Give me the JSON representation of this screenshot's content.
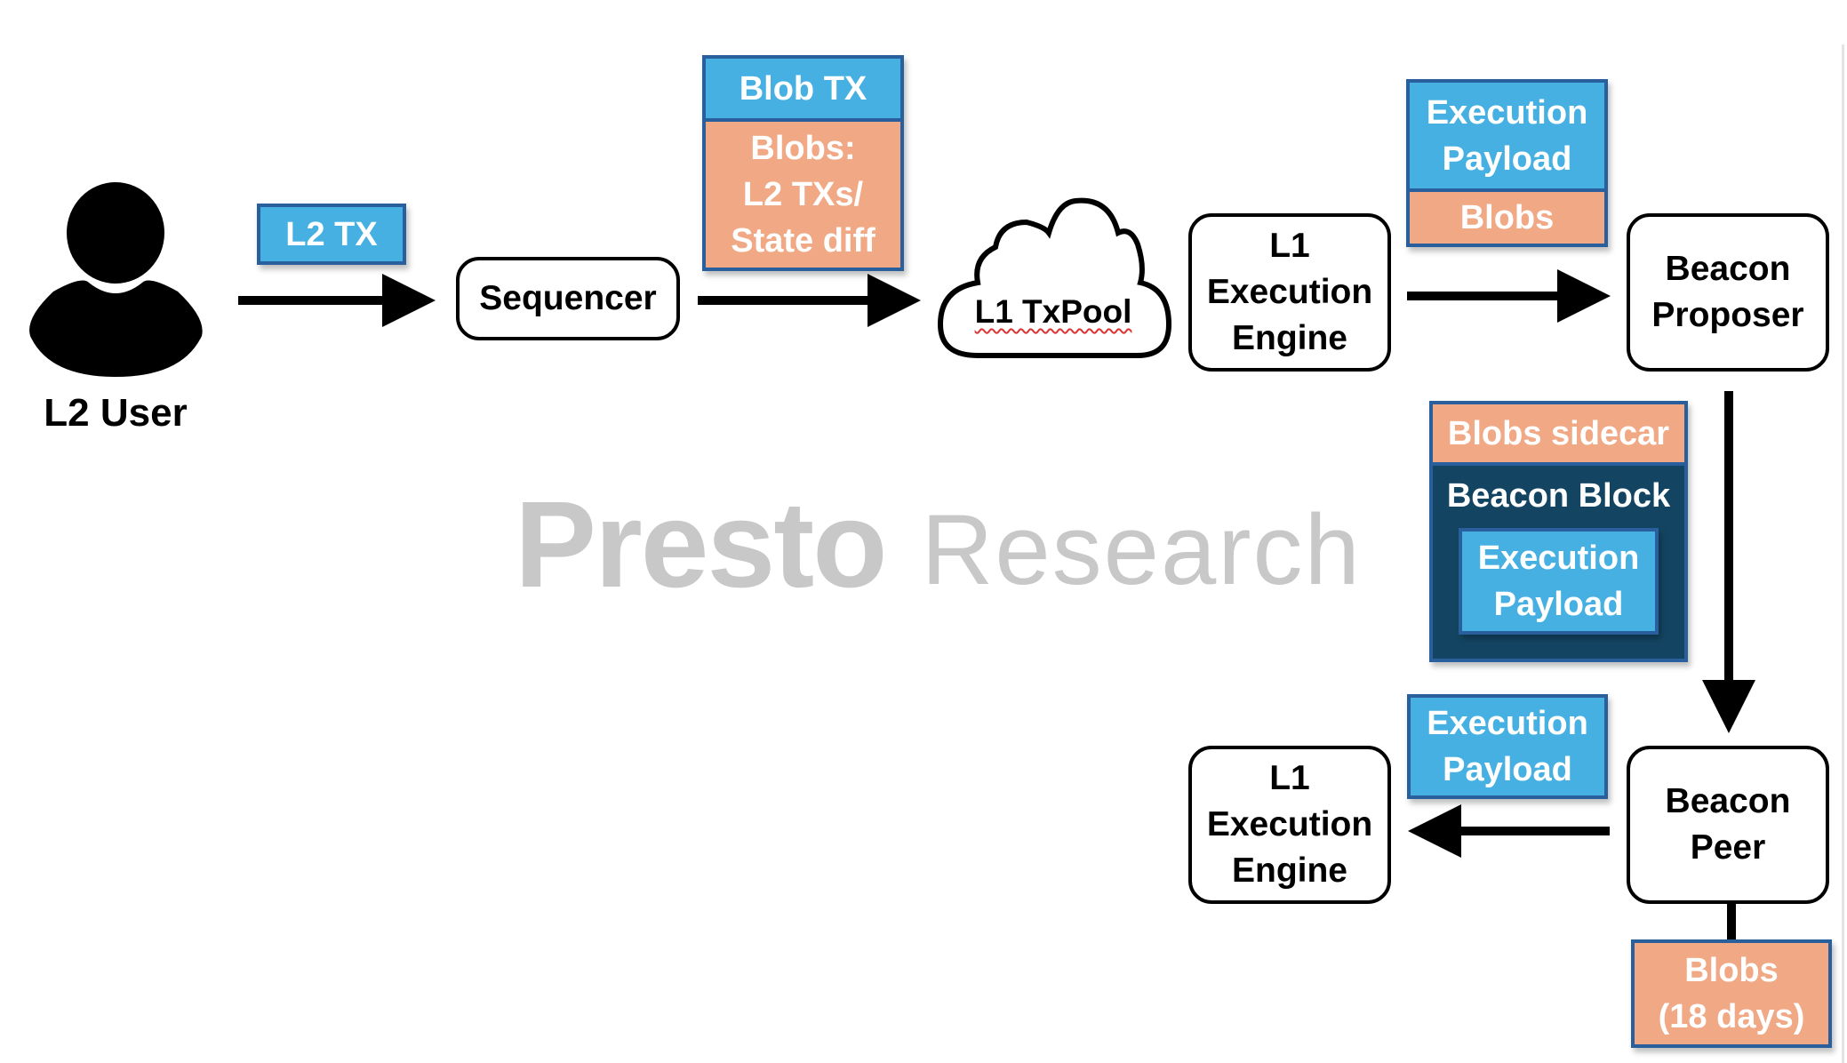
{
  "diagram": {
    "actors": {
      "l2_user": {
        "label": "L2 User",
        "icon": "person-icon"
      }
    },
    "nodes": {
      "sequencer": {
        "label": "Sequencer"
      },
      "l1_txpool": {
        "label": "L1 TxPool",
        "shape": "cloud"
      },
      "l1_execution_engine_top": {
        "lines": [
          "L1",
          "Execution",
          "Engine"
        ]
      },
      "beacon_proposer": {
        "lines": [
          "Beacon",
          "Proposer"
        ]
      },
      "l1_execution_engine_bottom": {
        "lines": [
          "L1",
          "Execution",
          "Engine"
        ]
      },
      "beacon_peer": {
        "lines": [
          "Beacon",
          "Peer"
        ]
      }
    },
    "payload_labels": {
      "l2_tx": {
        "label": "L2 TX"
      },
      "blob_tx": {
        "header": "Blob TX",
        "body_lines": [
          "Blobs:",
          "L2 TXs/",
          "State diff"
        ]
      },
      "engine_to_proposer": {
        "top_lines": [
          "Execution",
          "Payload"
        ],
        "bottom": "Blobs"
      },
      "proposer_to_peer": {
        "sidecar": "Blobs sidecar",
        "block": "Beacon Block",
        "inner_lines": [
          "Execution",
          "Payload"
        ]
      },
      "peer_to_engine": {
        "lines": [
          "Execution",
          "Payload"
        ]
      },
      "peer_storage": {
        "lines": [
          "Blobs",
          "(18 days)"
        ]
      }
    },
    "edges": [
      {
        "from": "L2 User",
        "to": "Sequencer",
        "label": "L2 TX"
      },
      {
        "from": "Sequencer",
        "to": "L1 TxPool",
        "label": "Blob TX"
      },
      {
        "from": "L1 Execution Engine",
        "to": "Beacon Proposer",
        "label": "Execution Payload + Blobs"
      },
      {
        "from": "Beacon Proposer",
        "to": "Beacon Peer",
        "label": "Blobs sidecar + Beacon Block"
      },
      {
        "from": "Beacon Peer",
        "to": "L1 Execution Engine",
        "label": "Execution Payload"
      },
      {
        "from": "Beacon Peer",
        "to": "Blobs (18 days)",
        "label": ""
      }
    ],
    "colors": {
      "payload_blue": "#45b0e1",
      "blob_salmon": "#f0a885",
      "beacon_block_navy": "#134562",
      "tag_border": "#2a5f9e",
      "watermark_gray": "#c8c8c8"
    },
    "watermark": {
      "brand": "Presto",
      "sub": "Research"
    }
  }
}
